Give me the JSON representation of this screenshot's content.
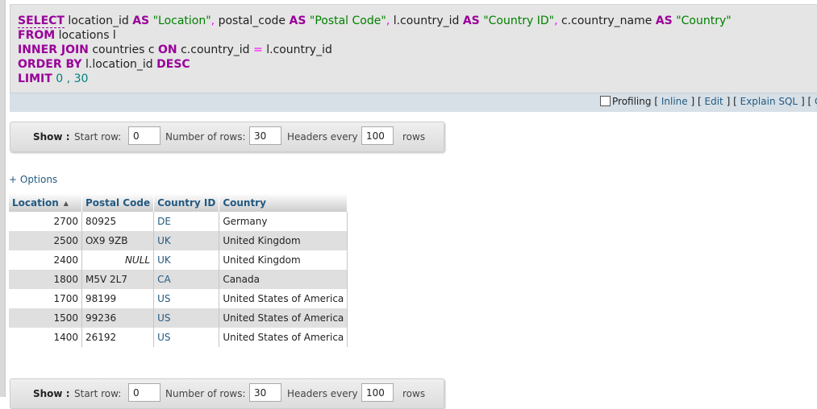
{
  "sql": {
    "line1": {
      "select": "SELECT",
      "col1": "location_id",
      "as1": "AS",
      "alias1": "\"Location\"",
      "comma1": ",",
      "col2": "postal_code",
      "as2": "AS",
      "alias2": "\"Postal Code\"",
      "comma2": ",",
      "col3": "l.country_id",
      "as3": "AS",
      "alias3": "\"Country ID\"",
      "comma3": ",",
      "col4": "c.country_name",
      "as4": "AS",
      "alias4": "\"Country\""
    },
    "line2": {
      "from": "FROM",
      "rest": "locations l"
    },
    "line3": {
      "join": "INNER JOIN",
      "t": "countries c",
      "on": "ON",
      "lhs": "c.country_id",
      "eq": "=",
      "rhs": "l.country_id"
    },
    "line4": {
      "order": "ORDER BY",
      "col": "l.location_id",
      "desc": "DESC"
    },
    "line5": {
      "limit": "LIMIT",
      "off": "0",
      "comma": ",",
      "count": "30"
    }
  },
  "toolbar": {
    "profiling": "Profiling",
    "bo": "[",
    "inline": "Inline",
    "bc": "]",
    "edit": "Edit",
    "explain": "Explain SQL",
    "create": "C"
  },
  "nav": {
    "show": "Show :",
    "start_row_label": "Start row:",
    "start_row": "0",
    "rows_label": "Number of rows:",
    "rows": "30",
    "headers_label": "Headers every",
    "headers": "100",
    "rows_suffix": "rows"
  },
  "options_link": "+ Options",
  "table": {
    "headers": [
      "Location",
      "Postal Code",
      "Country ID",
      "Country"
    ],
    "sort_icon": "▲",
    "rows": [
      {
        "location": "2700",
        "postal": "80925",
        "country_id": "DE",
        "country": "Germany"
      },
      {
        "location": "2500",
        "postal": "OX9 9ZB",
        "country_id": "UK",
        "country": "United Kingdom"
      },
      {
        "location": "2400",
        "postal": "NULL",
        "country_id": "UK",
        "country": "United Kingdom"
      },
      {
        "location": "1800",
        "postal": "M5V 2L7",
        "country_id": "CA",
        "country": "Canada"
      },
      {
        "location": "1700",
        "postal": "98199",
        "country_id": "US",
        "country": "United States of America"
      },
      {
        "location": "1500",
        "postal": "99236",
        "country_id": "US",
        "country": "United States of America"
      },
      {
        "location": "1400",
        "postal": "26192",
        "country_id": "US",
        "country": "United States of America"
      }
    ]
  }
}
